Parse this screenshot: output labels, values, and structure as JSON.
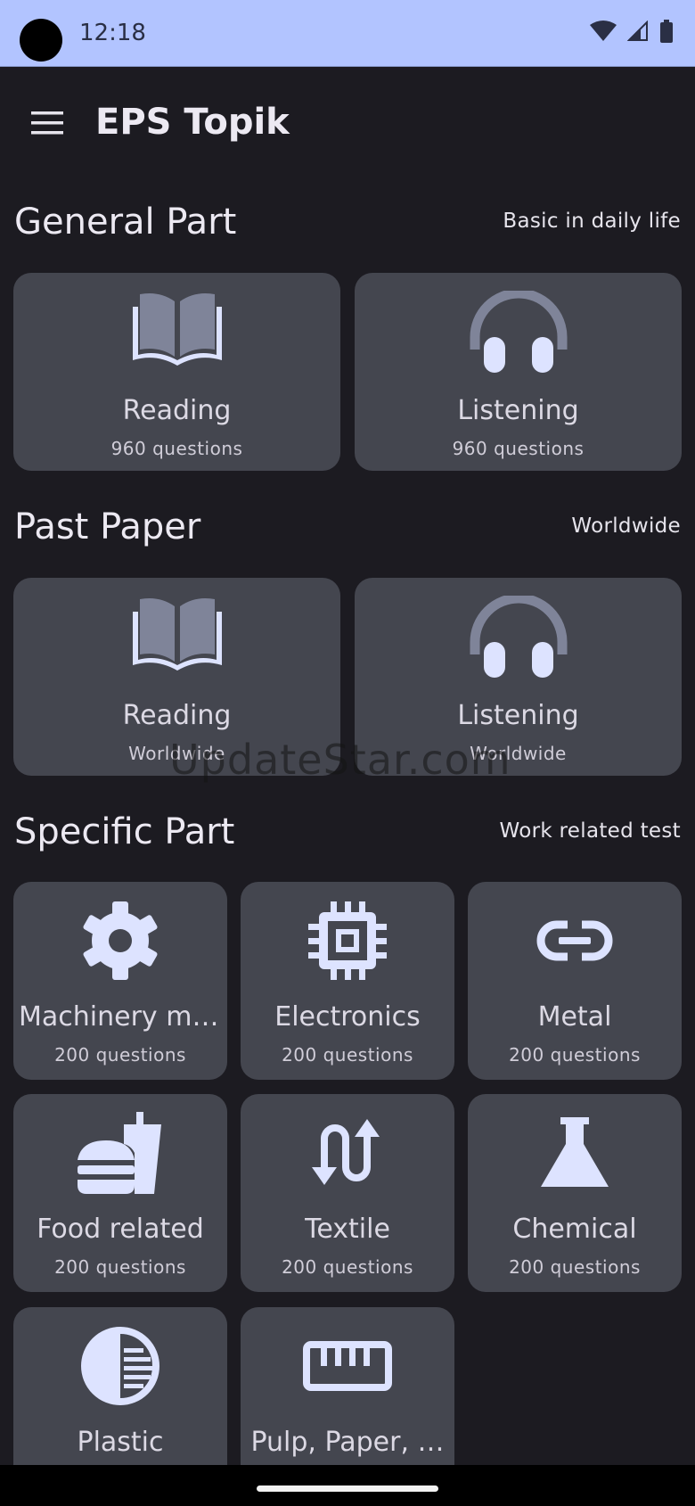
{
  "status_bar": {
    "time": "12:18"
  },
  "app_bar": {
    "title": "EPS Topik"
  },
  "sections": [
    {
      "title": "General Part",
      "subtitle": "Basic in daily life",
      "cards": [
        {
          "label": "Reading",
          "sub": "960 questions",
          "icon": "book-open-icon"
        },
        {
          "label": "Listening",
          "sub": "960 questions",
          "icon": "headphones-icon"
        }
      ]
    },
    {
      "title": "Past Paper",
      "subtitle": "Worldwide",
      "cards": [
        {
          "label": "Reading",
          "sub": "Worldwide",
          "icon": "book-open-icon"
        },
        {
          "label": "Listening",
          "sub": "Worldwide",
          "icon": "headphones-icon"
        }
      ]
    },
    {
      "title": "Specific Part",
      "subtitle": "Work related test",
      "cards": [
        {
          "label": "Machinery mo…",
          "sub": "200 questions",
          "icon": "gear-icon"
        },
        {
          "label": "Electronics",
          "sub": "200 questions",
          "icon": "chip-icon"
        },
        {
          "label": "Metal",
          "sub": "200 questions",
          "icon": "link-icon"
        },
        {
          "label": "Food related",
          "sub": "200 questions",
          "icon": "fastfood-icon"
        },
        {
          "label": "Textile",
          "sub": "200 questions",
          "icon": "swap-arrows-icon"
        },
        {
          "label": "Chemical",
          "sub": "200 questions",
          "icon": "flask-icon"
        },
        {
          "label": "Plastic",
          "sub": "",
          "icon": "contrast-icon"
        },
        {
          "label": "Pulp, Paper, …",
          "sub": "",
          "icon": "ruler-icon"
        }
      ]
    }
  ],
  "watermark": "UpdateStar.com",
  "colors": {
    "background": "#1c1b21",
    "card": "#44464f",
    "status_bar": "#b2c4ff",
    "icon_light": "#dde3ff",
    "icon_muted": "#7f8499"
  }
}
